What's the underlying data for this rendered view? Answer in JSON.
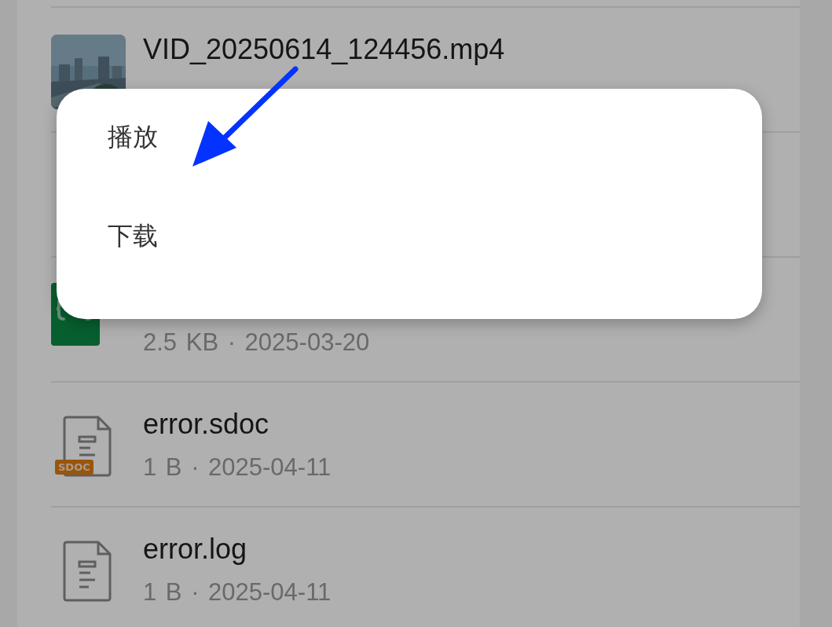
{
  "files": [
    {
      "kind": "video",
      "name": "VID_20250614_124456.mp4"
    },
    {
      "kind": "covered"
    },
    {
      "kind": "code",
      "meta": "2.5 KB · 2025-03-20"
    },
    {
      "kind": "sdoc",
      "badge": "SDOC",
      "name": "error.sdoc",
      "meta": "1 B · 2025-04-11"
    },
    {
      "kind": "doc",
      "name": "error.log",
      "meta": "1 B · 2025-04-11"
    }
  ],
  "menu": {
    "items": [
      {
        "label": "播放"
      },
      {
        "label": "下载"
      }
    ]
  }
}
